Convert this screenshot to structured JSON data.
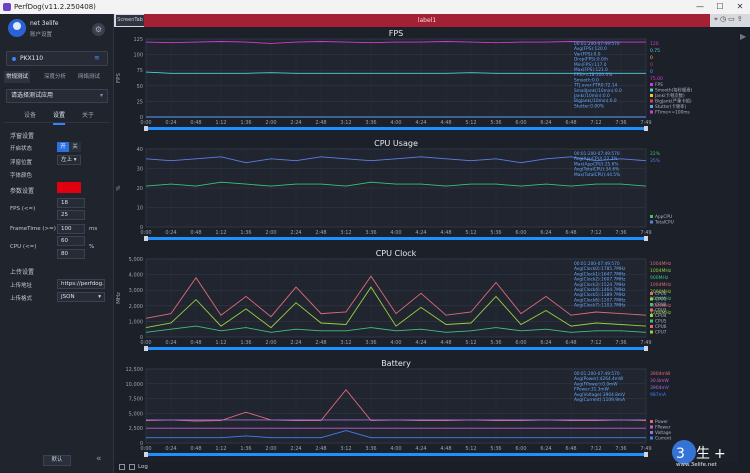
{
  "window": {
    "title": "PerfDog(v11.2.250408)",
    "controls": [
      "—",
      "☐",
      "✕"
    ]
  },
  "user": {
    "name": "net 3elife",
    "account": "账户设置"
  },
  "device": {
    "name": "PKX110"
  },
  "mode_tabs": [
    "常规测试",
    "深度分析",
    "网络测试"
  ],
  "app_select": {
    "value": "请选择测试应用"
  },
  "sub_tabs": [
    "设备",
    "设置",
    "关于"
  ],
  "float": {
    "title": "浮窗设置",
    "open_label": "开启状态",
    "on": "开",
    "off": "关",
    "pos_label": "浮窗位置",
    "pos_value": "左上",
    "color_label": "字体颜色"
  },
  "params": {
    "title": "参数设置",
    "fps_label": "FPS (<=)",
    "fps_v1": "18",
    "fps_v2": "25",
    "ft_label": "FrameTime (>=)",
    "ft_v": "100",
    "ft_unit": "ms",
    "cpu_label": "CPU (<=)",
    "cpu_v1": "60",
    "cpu_v2": "80",
    "cpu_unit": "%"
  },
  "upload": {
    "title": "上传设置",
    "addr_label": "上传地址",
    "addr_value": "https://perfdog.q",
    "fmt_label": "上传格式",
    "fmt_value": "JSON"
  },
  "buttons": {
    "default": "默认"
  },
  "tabs": {
    "screen": "ScreenTab",
    "label": "label1"
  },
  "status": {
    "log": "Log"
  },
  "watermark": {
    "site": "www.3elife.net"
  },
  "colors": {
    "accent": "#3b82f6",
    "tab_red": "#a32035",
    "grid": "#3a4150"
  },
  "time_ticks": [
    "0:00",
    "0:24",
    "0:48",
    "1:12",
    "1:36",
    "2:00",
    "2:24",
    "2:48",
    "3:12",
    "3:36",
    "4:00",
    "4:24",
    "4:48",
    "5:12",
    "5:36",
    "6:00",
    "6:24",
    "6:48",
    "7:12",
    "7:36",
    "7:49"
  ],
  "chart_data": [
    {
      "type": "line",
      "title": "FPS",
      "ylabel": "FPS",
      "yticks": [
        "0",
        "25",
        "50",
        "75",
        "100",
        "125"
      ],
      "ylim": [
        0,
        125
      ],
      "series": [
        {
          "name": "FPS",
          "color": "#d23bd8",
          "values": [
            120,
            119,
            120,
            121,
            120,
            118,
            120,
            121,
            120,
            119,
            120,
            120,
            121,
            120,
            119,
            120,
            120,
            121,
            120,
            120,
            120
          ]
        },
        {
          "name": "Smooth",
          "color": "#4fd1e0",
          "values": [
            72,
            70,
            70,
            70,
            70,
            71,
            70,
            70,
            70,
            70,
            70,
            70,
            70,
            71,
            70,
            70,
            70,
            70,
            70,
            70,
            70
          ]
        },
        {
          "name": "Jank",
          "color": "#f0c040",
          "values": [
            0,
            0,
            0,
            0,
            0,
            0,
            0,
            0,
            0,
            0,
            0,
            0,
            0,
            0,
            0,
            0,
            0,
            0,
            0,
            0,
            0
          ]
        },
        {
          "name": "BigJank",
          "color": "#e04040",
          "values": [
            0,
            0,
            0,
            0,
            0,
            0,
            0,
            0,
            0,
            0,
            0,
            0,
            0,
            0,
            0,
            0,
            0,
            0,
            0,
            0,
            0
          ]
        },
        {
          "name": "Stutter",
          "color": "#5aa0ff",
          "values": [
            0,
            0,
            0,
            0,
            0,
            0,
            0,
            0,
            0,
            0,
            0,
            0,
            0,
            0,
            0,
            0,
            0,
            0,
            0,
            0,
            0
          ]
        }
      ],
      "legend": [
        "FPS",
        "Smooth(每秒顺滑)",
        "Jank(卡顿次数)",
        "BigJank(严重卡顿)",
        "Stutter(卡顿率)",
        "FTime>=100ms"
      ],
      "stats_box": [
        "00:01:200-07:49:570",
        "Avg(FPS):120.0",
        "Var(FPS):0.0",
        "Drop(FPS):0.0/h",
        "Min(FPS):117.0",
        "Max(FPS):121.0",
        "FPS>=18:100.0%",
        "Smooth:0.0",
        "TTJ.over:FTR0:72.14",
        "SmallJank(/10min):0.0",
        "Jank(/10min):0.0",
        "BigJank(/10min):0.0",
        "Stutter:0.00%"
      ],
      "right_vals": [
        "120",
        "0.75",
        "0",
        "0",
        "0",
        "75.00"
      ]
    },
    {
      "type": "line",
      "title": "CPU Usage",
      "ylabel": "%",
      "yticks": [
        "0",
        "10",
        "20",
        "30",
        "40"
      ],
      "ylim": [
        0,
        40
      ],
      "series": [
        {
          "name": "AppCPU",
          "color": "#3ec46d",
          "values": [
            21,
            22,
            21,
            23,
            22,
            21,
            22,
            22,
            21,
            23,
            22,
            22,
            21,
            22,
            22,
            21,
            22,
            21,
            22,
            22,
            21
          ]
        },
        {
          "name": "TotalCPU",
          "color": "#5b7fe8",
          "values": [
            35,
            34,
            35,
            36,
            33,
            35,
            34,
            36,
            35,
            34,
            35,
            36,
            35,
            34,
            35,
            33,
            35,
            36,
            34,
            35,
            34
          ]
        }
      ],
      "legend": [
        "AppCPU",
        "TotalCPU"
      ],
      "stats_box": [
        "00:01:200-07:49:570",
        "Avg(AppCPU):22.3%",
        "Max(AppCPU):25.6%",
        "Avg(TotalCPU):34.6%",
        "Max(TotalCPU):44.5%"
      ],
      "right_vals": [
        "22%",
        "35%"
      ]
    },
    {
      "type": "line",
      "title": "CPU Clock",
      "ylabel": "MHz",
      "yticks": [
        "0",
        "1,000",
        "2,000",
        "3,000",
        "4,000",
        "5,000"
      ],
      "ylim": [
        0,
        5000
      ],
      "series": [
        {
          "name": "CPU0",
          "color": "#e06a7a",
          "values": [
            1200,
            1500,
            3800,
            1400,
            2600,
            1300,
            3200,
            1500,
            1600,
            3900,
            1500,
            2800,
            1400,
            1600,
            3500,
            1500,
            2600,
            1400,
            1600,
            1500,
            1400
          ]
        },
        {
          "name": "CPU1",
          "color": "#9ad040",
          "values": [
            600,
            900,
            2400,
            700,
            1800,
            600,
            2200,
            900,
            800,
            3200,
            700,
            1900,
            800,
            900,
            2600,
            800,
            1700,
            700,
            900,
            800,
            700
          ]
        },
        {
          "name": "CPU2",
          "color": "#40c080",
          "values": [
            300,
            500,
            700,
            400,
            600,
            300,
            500,
            400,
            400,
            600,
            400,
            500,
            300,
            400,
            600,
            400,
            500,
            300,
            400,
            400,
            300
          ]
        }
      ],
      "legend": [
        "CPU0",
        "CPU1",
        "CPU2",
        "CPU3",
        "CPU4",
        "CPU5",
        "CPU6",
        "CPU7"
      ],
      "stats_box": [
        "00:01:200-07:49:570",
        "Avg(Clock0):1785.7MHz",
        "Avg(Clock1):1647.7MHz",
        "Avg(Clock2):1607.7MHz",
        "Avg(Clock3):1524.7MHz",
        "Avg(Clock4):1464.7MHz",
        "Avg(Clock5):1389.7MHz",
        "Avg(Clock6):1207.7MHz",
        "Avg(Clock7):1103.7MHz"
      ],
      "right_vals": [
        "1004MHz",
        "1004MHz",
        "900MHz",
        "1004MHz",
        "2000MHz",
        "1004MHz",
        "1004MHz",
        "1200MHz"
      ]
    },
    {
      "type": "line",
      "title": "Battery",
      "ylabel": "",
      "yticks": [
        "0",
        "2,500",
        "5,000",
        "7,500",
        "10,000",
        "12,500"
      ],
      "ylim": [
        0,
        12500
      ],
      "series": [
        {
          "name": "Power",
          "color": "#e06a7a",
          "values": [
            3800,
            3900,
            3700,
            3800,
            5200,
            3900,
            3800,
            3800,
            9000,
            3800,
            3900,
            3800,
            3800,
            3900,
            3800,
            3800,
            3900,
            3800,
            3800,
            3900,
            3800
          ]
        },
        {
          "name": "FPower",
          "color": "#c060d0",
          "values": [
            2500,
            2500,
            2500,
            2500,
            2500,
            2500,
            2500,
            2500,
            2500,
            2500,
            2500,
            2500,
            2500,
            2500,
            2500,
            2500,
            2500,
            2500,
            2500,
            2500,
            2500
          ]
        },
        {
          "name": "Voltage",
          "color": "#a070e0",
          "values": [
            3900,
            3900,
            3900,
            3900,
            3900,
            3900,
            3900,
            3900,
            3900,
            3900,
            3900,
            3900,
            3900,
            3900,
            3900,
            3900,
            3900,
            3900,
            3900,
            3900,
            3900
          ]
        },
        {
          "name": "Current",
          "color": "#4080f0",
          "values": [
            900,
            900,
            900,
            900,
            1200,
            900,
            900,
            900,
            2100,
            900,
            900,
            900,
            900,
            900,
            900,
            900,
            900,
            900,
            900,
            900,
            900
          ]
        }
      ],
      "legend": [
        "Power",
        "FPower",
        "Voltage",
        "Current"
      ],
      "stats_box": [
        "00:01:200-07:49:570",
        "Avg(Power):4264.4mW",
        "Avg(FPower):0.0mW",
        "FPower:31.3mW",
        "Avg(Voltage):3904.8mV",
        "Avg(Current):1109.9mA"
      ],
      "right_vals": [
        "3904mW",
        "30.8mW",
        "3904mV",
        "987mA"
      ]
    }
  ]
}
